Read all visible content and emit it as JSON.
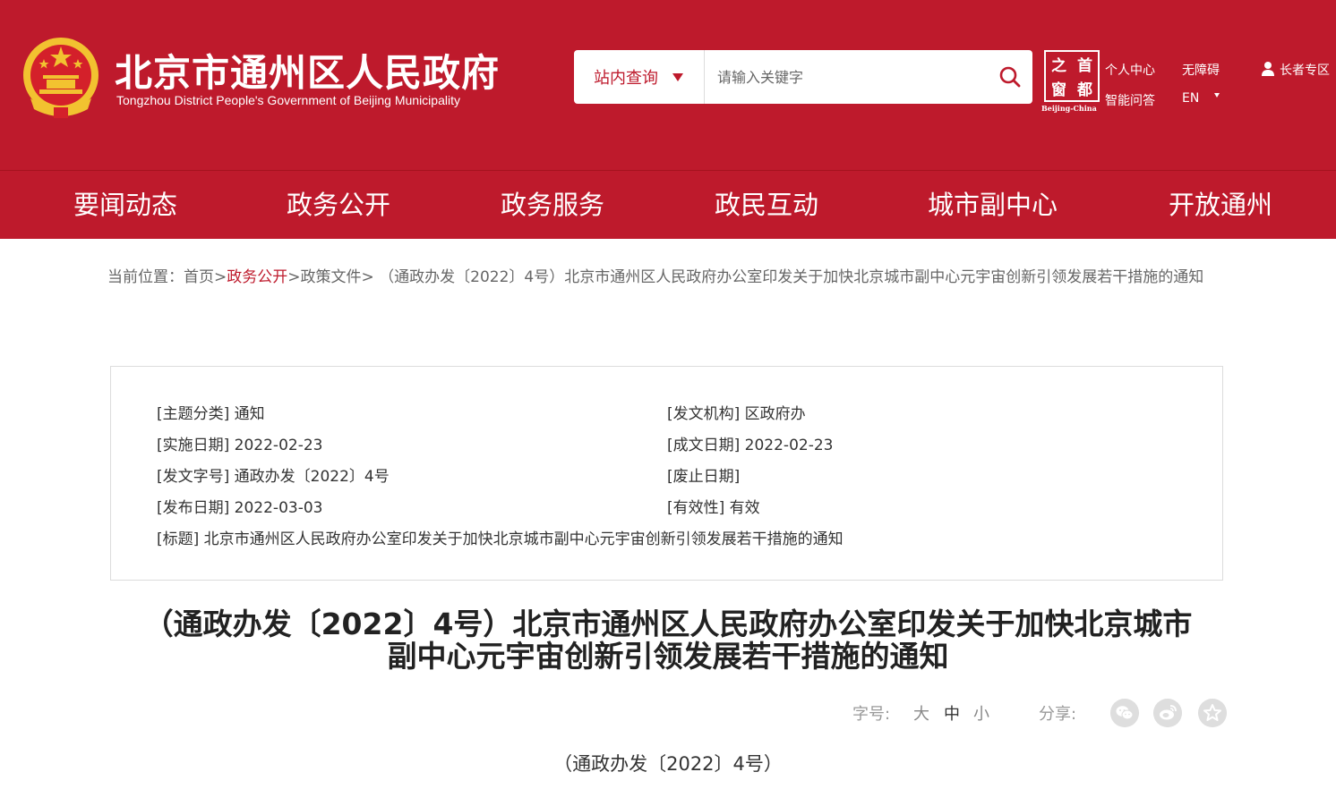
{
  "header": {
    "title": "北京市通州区人民政府",
    "subtitle": "Tongzhou District People's Government of Beijing Municipality",
    "search": {
      "scope": "站内查询",
      "placeholder": "请输入关键字"
    },
    "capital_logo": {
      "chars": [
        "之",
        "首",
        "窗",
        "都"
      ],
      "sub": "Beijing-China"
    },
    "links": {
      "personal": "个人中心",
      "accessible": "无障碍",
      "elder": "长者专区",
      "smart_qa": "智能问答",
      "lang": "EN"
    }
  },
  "nav": {
    "items": [
      "要闻动态",
      "政务公开",
      "政务服务",
      "政民互动",
      "城市副中心",
      "开放通州"
    ]
  },
  "breadcrumb": {
    "prefix": "当前位置：",
    "home": "首页",
    "sep": ">",
    "public": "政务公开",
    "policy": "政策文件",
    "current": "（通政办发〔2022〕4号）北京市通州区人民政府办公室印发关于加快北京城市副中心元宇宙创新引领发展若干措施的通知"
  },
  "meta": {
    "topic": "[主题分类] 通知",
    "org": "[发文机构] 区政府办",
    "impl_date": "[实施日期] 2022-02-23",
    "made_date": "[成文日期] 2022-02-23",
    "doc_no": "[发文字号] 通政办发〔2022〕4号",
    "abolish": "[废止日期]",
    "pub_date": "[发布日期] 2022-03-03",
    "validity": "[有效性] 有效",
    "title": "[标题] 北京市通州区人民政府办公室印发关于加快北京城市副中心元宇宙创新引领发展若干措施的通知"
  },
  "article": {
    "title_line1": "（通政办发〔2022〕4号）北京市通州区人民政府办公室印发关于加快北京城市",
    "title_line2": "副中心元宇宙创新引领发展若干措施的通知",
    "number": "（通政办发〔2022〕4号）"
  },
  "tools": {
    "font_label": "字号:",
    "large": "大",
    "medium": "中",
    "small": "小",
    "share_label": "分享:",
    "share_icons": [
      "wechat-icon",
      "weibo-icon",
      "favorite-icon"
    ]
  },
  "colors": {
    "brand_red": "#be1a2c",
    "gold": "#f2c230"
  }
}
